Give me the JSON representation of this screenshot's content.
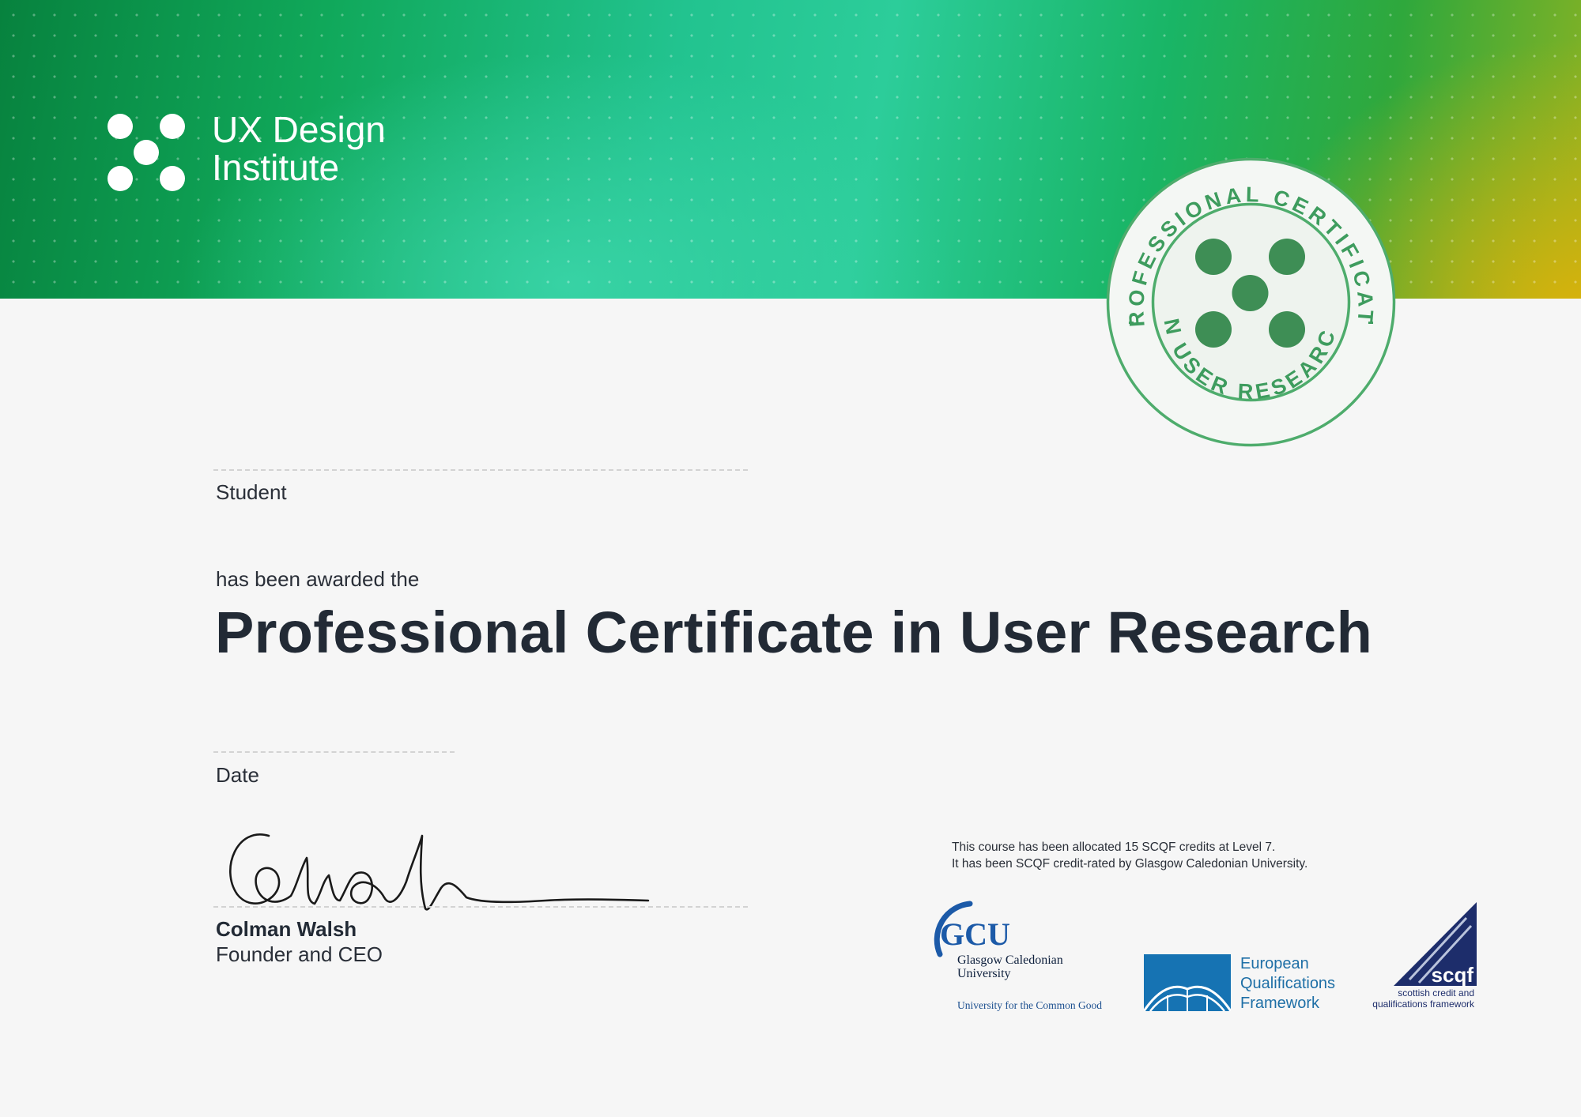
{
  "colors": {
    "header_start": "#07823e",
    "header_mid": "#2ccd9a",
    "header_end": "#deb20a",
    "seal_green": "#3e9c5e",
    "seal_ring": "#4eac6c",
    "title_text": "#222a35",
    "gcu_blue": "#1c5aa8",
    "eqf_blue": "#1e6fa6",
    "scqf_navy": "#1d2d6b"
  },
  "brand": {
    "name_line1": "UX Design",
    "name_line2": "Institute",
    "logo_icon": "five-dot-logo-icon"
  },
  "seal": {
    "top_text": "PROFESSIONAL CERTIFICATE",
    "bottom_text": "IN USER RESEARCH",
    "separator": "-",
    "icon": "five-dot-logo-icon"
  },
  "certificate": {
    "student_label": "Student",
    "awarded_text": "has been awarded the",
    "title": "Professional Certificate in User Research",
    "date_label": "Date"
  },
  "signatory": {
    "name": "Colman Walsh",
    "role": "Founder and CEO"
  },
  "accreditation": {
    "line1": "This course has been allocated 15 SCQF credits at Level 7.",
    "line2": "It has been SCQF credit-rated by Glasgow Caledonian University."
  },
  "partners": {
    "gcu": {
      "abbr": "GCU",
      "name_line1": "Glasgow Caledonian",
      "name_line2": "University",
      "tagline": "University for the Common Good"
    },
    "eqf": {
      "line1": "European",
      "line2": "Qualifications",
      "line3": "Framework"
    },
    "scqf": {
      "abbr": "scqf",
      "caption_line1": "scottish credit and",
      "caption_line2": "qualifications framework"
    }
  }
}
